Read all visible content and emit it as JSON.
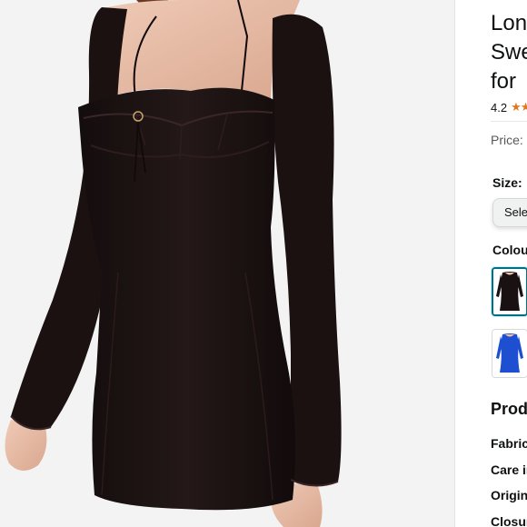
{
  "product": {
    "title_lines": [
      "Lon",
      "Swe",
      "for "
    ],
    "rating": "4.2",
    "stars": "★★",
    "price_label": "Price:"
  },
  "size": {
    "label": "Size:",
    "select_value": "Sele"
  },
  "colour": {
    "label": "Colou",
    "swatches": [
      {
        "name": "black",
        "hex": "#1a1212",
        "selected": true
      },
      {
        "name": "blue",
        "hex": "#1f4fd1",
        "selected": false
      }
    ]
  },
  "details": {
    "heading": "Prod",
    "rows": [
      "Fabric",
      "Care in",
      "Origin",
      "Closur"
    ]
  },
  "colors": {
    "accent": "#007185",
    "star": "#de7921",
    "dress": "#1d1414",
    "skin": "#e8c2ad",
    "background": "#f3f3f3"
  }
}
